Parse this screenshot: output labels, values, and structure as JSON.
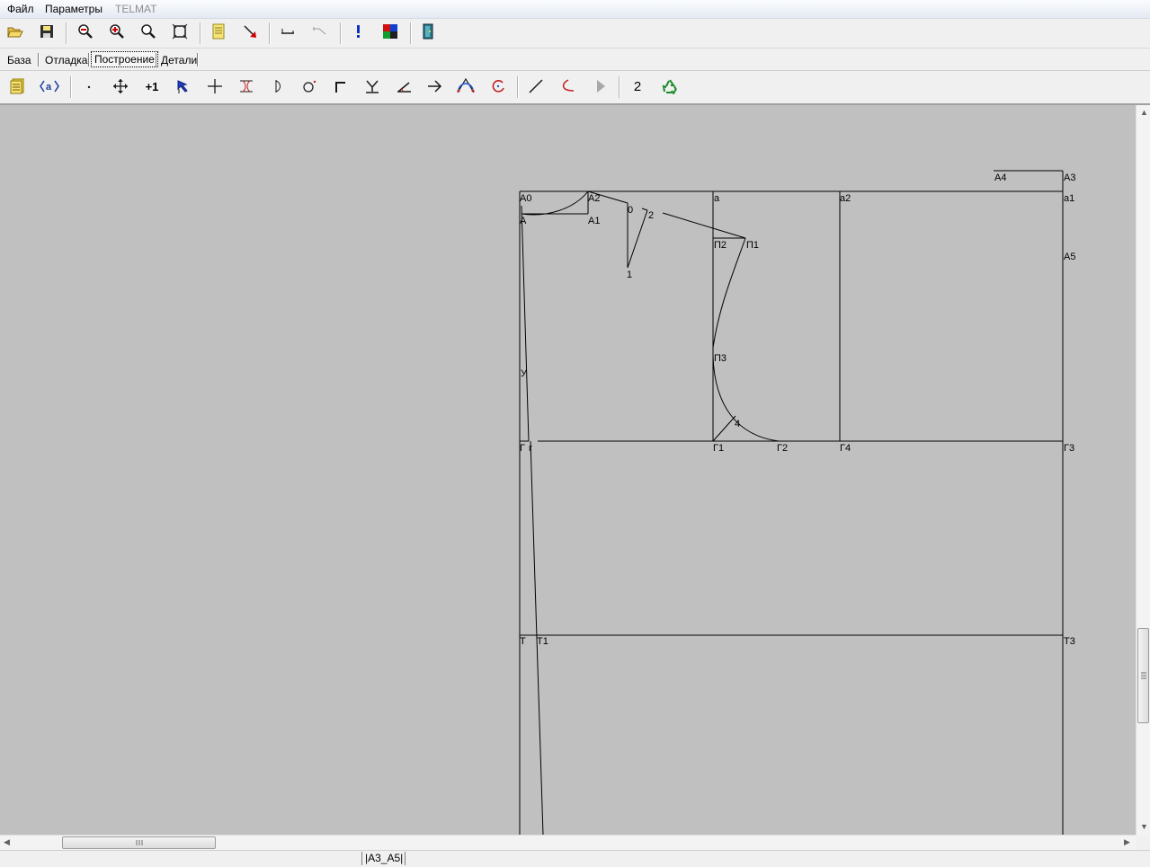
{
  "menu": {
    "file": "Файл",
    "params": "Параметры",
    "telmat": "TELMAT"
  },
  "tabs": [
    "База",
    "Отладка",
    "Построение",
    "Детали"
  ],
  "active_tab": "Построение",
  "toolbar2_number": "2",
  "toolbar2_plus_one": "+1",
  "status": {
    "selection": "|A3_A5|"
  },
  "drawing": {
    "labels": {
      "A4": "A4",
      "A3": "A3",
      "A0": "A0",
      "A2": "A2",
      "a": "a",
      "a2": "a2",
      "a1": "a1",
      "A": "A",
      "A1": "A1",
      "p0": "0",
      "p2": "2",
      "P2": "П2",
      "P1": "П1",
      "A5": "A5",
      "p1": "1",
      "P3": "П3",
      "U": "У",
      "p4": "4",
      "G": "Г",
      "g": "г",
      "G1": "Г1",
      "G2": "Г2",
      "G4": "Г4",
      "G3": "Г3",
      "T": "Т",
      "T1": "Т1",
      "T3": "Т3"
    }
  },
  "colors": {
    "canvas": "#c0c0c0",
    "lines": "#000000",
    "menubar": "#eef2f9"
  }
}
